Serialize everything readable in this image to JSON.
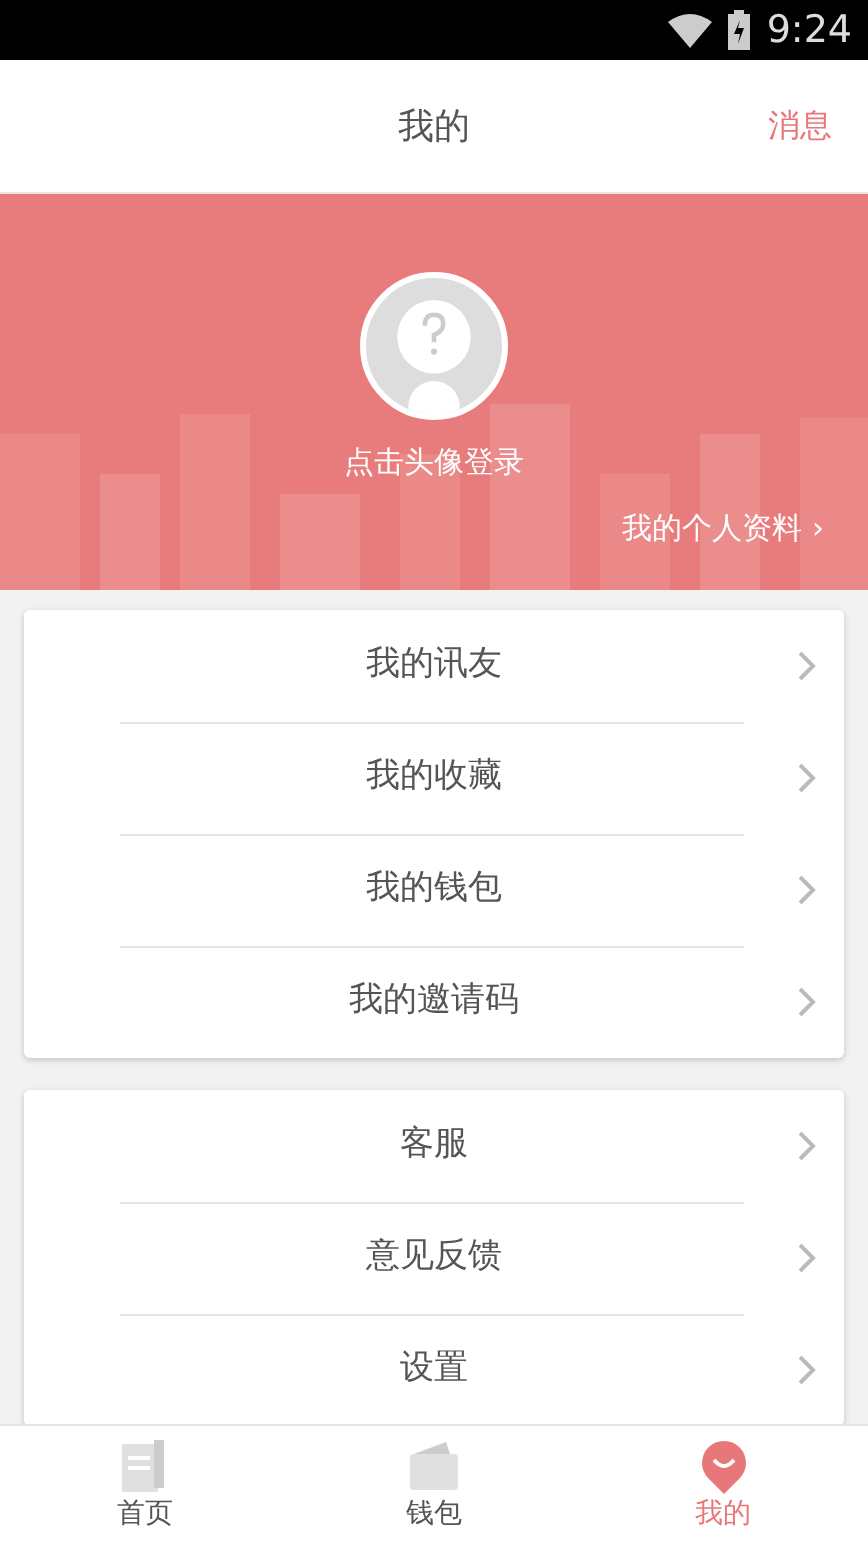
{
  "status_bar": {
    "time": "9:24"
  },
  "header": {
    "title": "我的",
    "action": "消息"
  },
  "profile": {
    "login_prompt": "点击头像登录",
    "profile_link": "我的个人资料",
    "chevron": "›"
  },
  "menu_groups": [
    {
      "items": [
        {
          "label": "我的讯友"
        },
        {
          "label": "我的收藏"
        },
        {
          "label": "我的钱包"
        },
        {
          "label": "我的邀请码"
        }
      ]
    },
    {
      "items": [
        {
          "label": "客服"
        },
        {
          "label": "意见反馈"
        },
        {
          "label": "设置"
        }
      ]
    }
  ],
  "tab_bar": [
    {
      "label": "首页",
      "kind": "home",
      "selected": false
    },
    {
      "label": "钱包",
      "kind": "wallet",
      "selected": false
    },
    {
      "label": "我的",
      "kind": "me",
      "selected": true
    }
  ]
}
